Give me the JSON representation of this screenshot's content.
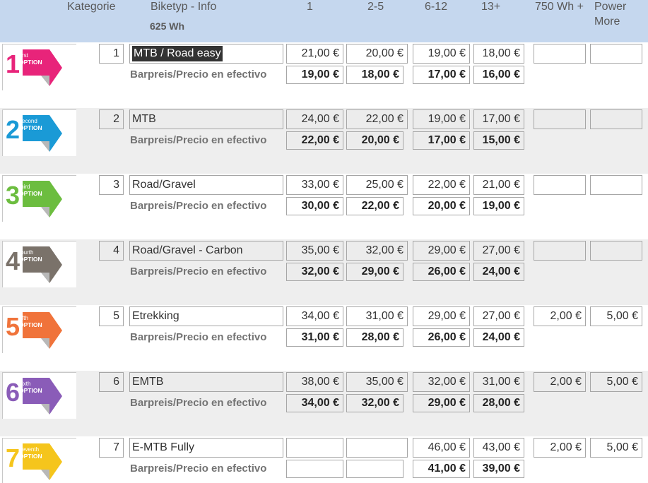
{
  "header": {
    "kategorie": "Kategorie",
    "biketyp": "Biketyp - Info",
    "wh": "625 Wh",
    "col1": "1",
    "col2": "2-5",
    "col3": "6-12",
    "col4": "13+",
    "col5": "750 Wh +",
    "col6_line1": "Power",
    "col6_line2": "More"
  },
  "cash_label": "Barpreis/Precio en efectivo",
  "rows": [
    {
      "num": "1",
      "biketyp": "MTB / Road easy",
      "logo": {
        "digit": "1",
        "word": "first",
        "option": "OPTION",
        "color": "#e8247a"
      },
      "prices": [
        "21,00 €",
        "20,00 €",
        "19,00 €",
        "18,00 €"
      ],
      "cash": [
        "19,00 €",
        "18,00 €",
        "17,00 €",
        "16,00 €"
      ],
      "wh750": "",
      "power": ""
    },
    {
      "num": "2",
      "biketyp": "MTB",
      "logo": {
        "digit": "2",
        "word": "second",
        "option": "OPTION",
        "color": "#1a9ad6"
      },
      "prices": [
        "24,00 €",
        "22,00 €",
        "19,00 €",
        "17,00 €"
      ],
      "cash": [
        "22,00 €",
        "20,00 €",
        "17,00 €",
        "15,00 €"
      ],
      "wh750": "",
      "power": ""
    },
    {
      "num": "3",
      "biketyp": "Road/Gravel",
      "logo": {
        "digit": "3",
        "word": "third",
        "option": "OPTION",
        "color": "#6cbd3f"
      },
      "prices": [
        "33,00 €",
        "25,00 €",
        "22,00 €",
        "21,00 €"
      ],
      "cash": [
        "30,00 €",
        "22,00 €",
        "20,00 €",
        "19,00 €"
      ],
      "wh750": "",
      "power": ""
    },
    {
      "num": "4",
      "biketyp": "Road/Gravel - Carbon",
      "logo": {
        "digit": "4",
        "word": "fourth",
        "option": "OPTION",
        "color": "#7a726a"
      },
      "prices": [
        "35,00 €",
        "32,00 €",
        "29,00 €",
        "27,00 €"
      ],
      "cash": [
        "32,00 €",
        "29,00 €",
        "26,00 €",
        "24,00 €"
      ],
      "wh750": "",
      "power": ""
    },
    {
      "num": "5",
      "biketyp": "Etrekking",
      "logo": {
        "digit": "5",
        "word": "fifth",
        "option": "OPTION",
        "color": "#f0733a"
      },
      "prices": [
        "34,00 €",
        "31,00 €",
        "29,00 €",
        "27,00 €"
      ],
      "cash": [
        "31,00 €",
        "28,00 €",
        "26,00 €",
        "24,00 €"
      ],
      "wh750": "2,00 €",
      "power": "5,00 €"
    },
    {
      "num": "6",
      "biketyp": "EMTB",
      "logo": {
        "digit": "6",
        "word": "sixth",
        "option": "OPTION",
        "color": "#8a5cb8"
      },
      "prices": [
        "38,00 €",
        "35,00 €",
        "32,00 €",
        "31,00 €"
      ],
      "cash": [
        "34,00 €",
        "32,00 €",
        "29,00 €",
        "28,00 €"
      ],
      "wh750": "2,00 €",
      "power": "5,00 €"
    },
    {
      "num": "7",
      "biketyp": "E-MTB Fully",
      "logo": {
        "digit": "7",
        "word": "seventh",
        "option": "OPTION",
        "color": "#f5c51c"
      },
      "prices": [
        "",
        "",
        "46,00 €",
        "43,00 €"
      ],
      "cash": [
        "",
        "",
        "41,00 €",
        "39,00 €"
      ],
      "wh750": "2,00 €",
      "power": "5,00 €"
    }
  ]
}
